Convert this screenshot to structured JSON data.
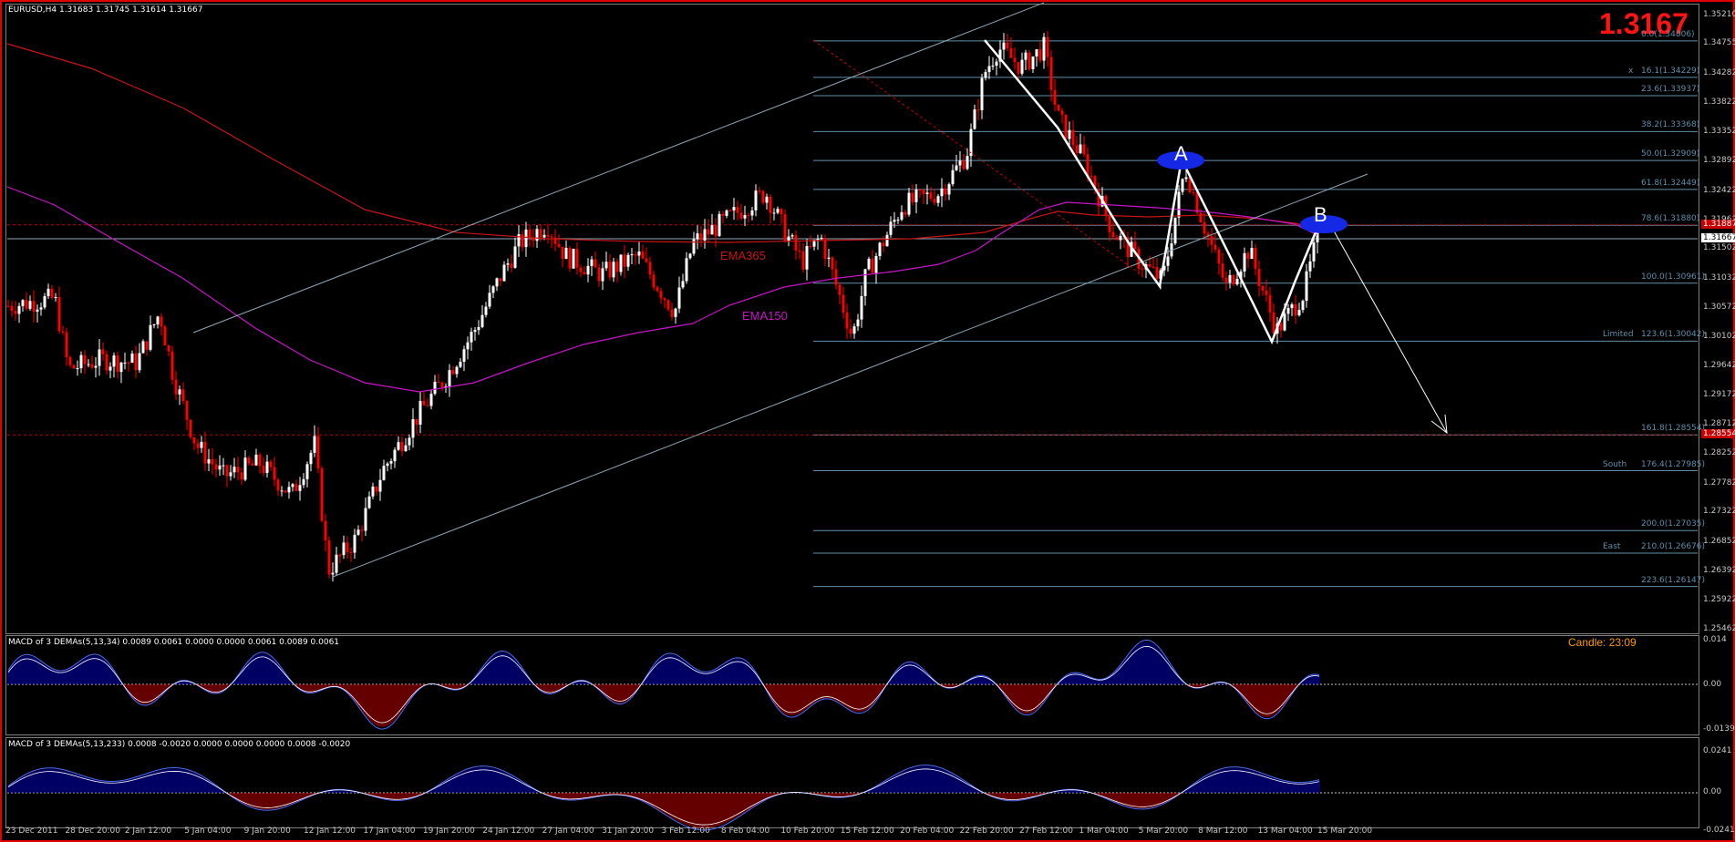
{
  "window": {
    "symbol_header": "EURUSD,H4  1.31683 1.31745 1.31614 1.31667",
    "big_price": "1.3167",
    "candle_timer": "Candle:  23:09"
  },
  "indicators": {
    "macd1_header": "MACD of 3 DEMAs(5,13,34) 0.0089 0.0061 0.0000 0.0000 0.0061 0.0089 0.0061",
    "macd2_header": "MACD of 3 DEMAs(5,13,233) 0.0008 -0.0020 0.0000 0.0000 0.0000 0.0008 -0.0020",
    "macd1_scale": [
      "0.014",
      "0.00",
      "-0.0139"
    ],
    "macd2_scale": [
      "0.0241",
      "0.00",
      "-0.0241"
    ],
    "ema365_label": "EMA365",
    "ema150_label": "EMA150"
  },
  "price_scale": [
    "1.35210",
    "1.34755",
    "1.34282",
    "1.33822",
    "1.33352",
    "1.32892",
    "1.32422",
    "1.31962",
    "1.31502",
    "1.31032",
    "1.30572",
    "1.30102",
    "1.29642",
    "1.29172",
    "1.28712",
    "1.28252",
    "1.27782",
    "1.27322",
    "1.26852",
    "1.26392",
    "1.25922",
    "1.25462"
  ],
  "price_markers": {
    "current": "1.31667",
    "upper_red": "1.31887",
    "lower_red": "1.28554"
  },
  "time_axis": [
    "23 Dec 2011",
    "28 Dec 20:00",
    "2 Jan 12:00",
    "5 Jan 04:00",
    "9 Jan 20:00",
    "12 Jan 12:00",
    "17 Jan 04:00",
    "19 Jan 20:00",
    "24 Jan 12:00",
    "27 Jan 04:00",
    "31 Jan 20:00",
    "3 Feb 12:00",
    "8 Feb 04:00",
    "10 Feb 20:00",
    "15 Feb 12:00",
    "20 Feb 04:00",
    "22 Feb 20:00",
    "27 Feb 12:00",
    "1 Mar 04:00",
    "5 Mar 20:00",
    "8 Mar 12:00",
    "13 Mar 04:00",
    "15 Mar 20:00"
  ],
  "fib_levels": [
    {
      "label": "0.0(1.34806)",
      "tag": ""
    },
    {
      "label": "16.1(1.34229)",
      "tag": "x"
    },
    {
      "label": "23.6(1.33937)",
      "tag": ""
    },
    {
      "label": "38.2(1.33368)",
      "tag": ""
    },
    {
      "label": "50.0(1.32909)",
      "tag": ""
    },
    {
      "label": "61.8(1.32449)",
      "tag": ""
    },
    {
      "label": "78.6(1.31880)",
      "tag": ""
    },
    {
      "label": "100.0(1.30961)",
      "tag": ""
    },
    {
      "label": "123.6(1.30042)",
      "tag": "Limited"
    },
    {
      "label": "161.8(1.28554)",
      "tag": ""
    },
    {
      "label": "176.4(1.27985)",
      "tag": "South"
    },
    {
      "label": "200.0(1.27035)",
      "tag": ""
    },
    {
      "label": "210.0(1.26676)",
      "tag": "East"
    },
    {
      "label": "223.6(1.26147)",
      "tag": ""
    }
  ],
  "points": {
    "a": "A",
    "b": "B"
  },
  "colors": {
    "bull": "#ffffff",
    "bear": "#ff0000",
    "ema365": "#c81414",
    "ema150": "#c814c8",
    "histo_pos": "#0000c8",
    "histo_neg": "#c80000",
    "fib": "#5f8fa8",
    "frame": "#e00000"
  }
}
